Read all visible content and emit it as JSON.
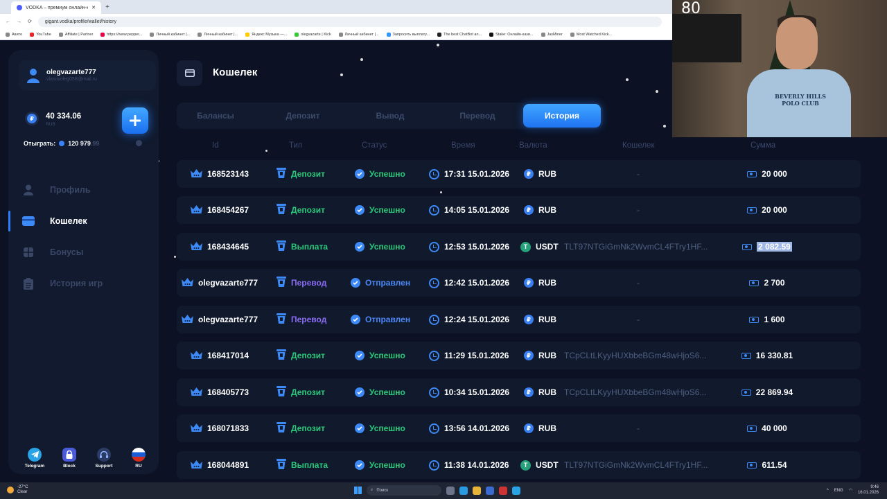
{
  "browser": {
    "tab_title": "VODKA – премиум онлайн-ка...",
    "tab_close": "✕",
    "new_tab": "+",
    "url": "gigant.vodka/profile/wallet/history",
    "bookmarks": [
      "Авито",
      "YouTube",
      "Affiliate | Partner",
      "https://www.pepper...",
      "Личный кабинет |...",
      "Личный кабинет |...",
      "Яндекс Музыка —...",
      "olegvazarte | Kick",
      "Личный кабинет |...",
      "Запросить выплату...",
      "The best ChatBot an...",
      "Stake: Онлайн-кази...",
      "JasMiner",
      "Most Watched Kick..."
    ]
  },
  "sidebar": {
    "username": "olegvazarte777",
    "email": "vlasovoleg058@mail.ru",
    "balance": "40 334.06",
    "currency": "RUB",
    "plus_label": "+",
    "wager_label": "Отыграть:",
    "wager_value": "120 979",
    "wager_frac": ".99",
    "nav": [
      {
        "label": "Профиль",
        "icon": "user-icon"
      },
      {
        "label": "Кошелек",
        "icon": "wallet-icon"
      },
      {
        "label": "Бонусы",
        "icon": "gift-icon"
      },
      {
        "label": "История игр",
        "icon": "clipboard-icon"
      }
    ],
    "footer": [
      {
        "label": "Telegram",
        "icon": "telegram-icon",
        "color": "#2aa3e6"
      },
      {
        "label": "Block",
        "icon": "lock-icon",
        "color": "#5b6ff0"
      },
      {
        "label": "Support",
        "icon": "headset-icon",
        "color": "#3a4f80"
      },
      {
        "label": "RU",
        "icon": "russia-flag-icon",
        "color": "#d52b1e"
      }
    ]
  },
  "header": {
    "title": "Кошелек"
  },
  "tabs": [
    "Балансы",
    "Депозит",
    "Вывод",
    "Перевод",
    "История"
  ],
  "active_tab": "История",
  "table": {
    "columns": [
      "Id",
      "Тип",
      "Статус",
      "Время",
      "Валюта",
      "Кошелек",
      "Сумма"
    ],
    "rows": [
      {
        "id": "168523143",
        "type": "Депозит",
        "status": "Успешно",
        "time": "17:31 15.01.2026",
        "cur": "RUB",
        "wallet": "-",
        "amount": "20 000"
      },
      {
        "id": "168454267",
        "type": "Депозит",
        "status": "Успешно",
        "time": "14:05 15.01.2026",
        "cur": "RUB",
        "wallet": "-",
        "amount": "20 000"
      },
      {
        "id": "168434645",
        "type": "Выплата",
        "status": "Успешно",
        "time": "12:53 15.01.2026",
        "cur": "USDT",
        "wallet": "TLT97NTGiGmNk2WvmCL4FTry1HF...",
        "amount": "2 082.59"
      },
      {
        "id": "olegvazarte777",
        "type": "Перевод",
        "status": "Отправлен",
        "time": "12:42 15.01.2026",
        "cur": "RUB",
        "wallet": "-",
        "amount": "2 700"
      },
      {
        "id": "olegvazarte777",
        "type": "Перевод",
        "status": "Отправлен",
        "time": "12:24 15.01.2026",
        "cur": "RUB",
        "wallet": "-",
        "amount": "1 600"
      },
      {
        "id": "168417014",
        "type": "Депозит",
        "status": "Успешно",
        "time": "11:29 15.01.2026",
        "cur": "RUB",
        "wallet": "TCpCLtLKyyHUXbbeBGm48wHjoS6...",
        "amount": "16 330.81"
      },
      {
        "id": "168405773",
        "type": "Депозит",
        "status": "Успешно",
        "time": "10:34 15.01.2026",
        "cur": "RUB",
        "wallet": "TCpCLtLKyyHUXbbeBGm48wHjoS6...",
        "amount": "22 869.94"
      },
      {
        "id": "168071833",
        "type": "Депозит",
        "status": "Успешно",
        "time": "13:56 14.01.2026",
        "cur": "RUB",
        "wallet": "-",
        "amount": "40 000"
      },
      {
        "id": "168044891",
        "type": "Выплата",
        "status": "Успешно",
        "time": "11:38 14.01.2026",
        "cur": "USDT",
        "wallet": "TLT97NTGiGmNk2WvmCL4FTry1HF...",
        "amount": "611.54"
      }
    ]
  },
  "webcam": {
    "counter": "80",
    "shirt_text": "BEVERLY HILLS POLO CLUB"
  },
  "taskbar": {
    "temp": "-27°C",
    "weather": "Clear",
    "search_placeholder": "Поиск",
    "lang": "ENG",
    "time": "9:46",
    "date": "16.01.2026"
  }
}
